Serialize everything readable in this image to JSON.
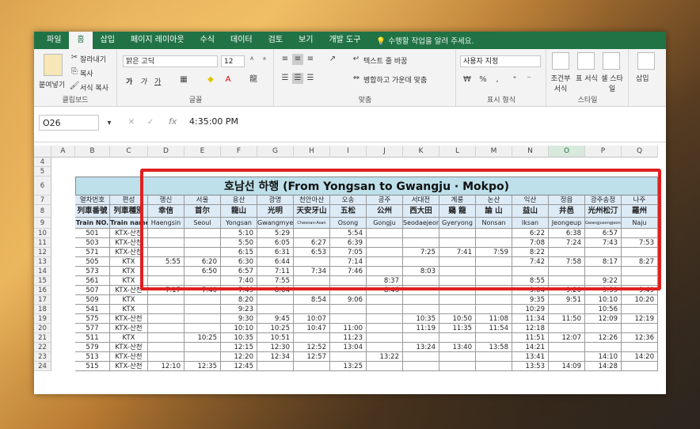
{
  "ribbon": {
    "tabs": [
      "파일",
      "홈",
      "삽입",
      "페이지 레이아웃",
      "수식",
      "데이터",
      "검토",
      "보기",
      "개발 도구"
    ],
    "active_tab": "홈",
    "tell_me": "수행할 작업을 알려 주세요.",
    "clipboard": {
      "paste": "붙여넣기",
      "cut": "잘라내기",
      "copy": "복사",
      "format_painter": "서식 복사",
      "label": "클립보드"
    },
    "font": {
      "name": "맑은 고딕",
      "size": "12",
      "label": "글꼴",
      "bold": "가",
      "italic": "가",
      "underline": "가"
    },
    "alignment": {
      "wrap": "텍스트 줄 바꿈",
      "merge": "병합하고 가운데 맞춤",
      "label": "맞춤"
    },
    "number": {
      "format": "사용자 지정",
      "label": "표시 형식"
    },
    "styles": {
      "conditional": "조건부 서식",
      "table": "표 서식",
      "cell": "셀 스타일",
      "label": "스타일"
    },
    "cells": {
      "insert": "삽입"
    }
  },
  "formula_bar": {
    "name_box": "O26",
    "value": "4:35:00 PM",
    "fx": "fx"
  },
  "columns": [
    "A",
    "B",
    "C",
    "D",
    "E",
    "F",
    "G",
    "H",
    "I",
    "J",
    "K",
    "L",
    "M",
    "N",
    "O",
    "P",
    "Q"
  ],
  "selected_column": "O",
  "row_numbers": [
    "4",
    "5",
    "6",
    "7",
    "8",
    "9",
    "10",
    "11",
    "12",
    "13",
    "14",
    "15",
    "16",
    "17",
    "18",
    "19",
    "20",
    "21",
    "22",
    "23",
    "24"
  ],
  "table": {
    "title": "호남선 하행 (From Yongsan to Gwangju · Mokpo)",
    "header_ko": [
      "열차번호",
      "편성",
      "행신",
      "서울",
      "용산",
      "광명",
      "천안아산",
      "오송",
      "공주",
      "서대전",
      "계룡",
      "논산",
      "익산",
      "정읍",
      "광주송정",
      "나주"
    ],
    "header_hanja": [
      "列車番號",
      "列車種別",
      "幸信",
      "首尔",
      "龍山",
      "光明",
      "天安牙山",
      "五松",
      "公州",
      "西大田",
      "鷄 龍",
      "論 山",
      "益山",
      "井邑",
      "光州松汀",
      "羅州"
    ],
    "header_en": [
      "Train NO.",
      "Train name",
      "Haengsin",
      "Seoul",
      "Yongsan",
      "Gwangmyeong",
      "Cheonan-Asan",
      "Osong",
      "Gongju",
      "Seodaejeon",
      "Gyeryong",
      "Nonsan",
      "Iksan",
      "Jeongeup",
      "Gwangjusongjeong",
      "Naju"
    ],
    "rows": [
      [
        "501",
        "KTX-산천",
        "",
        "",
        "5:10",
        "5:29",
        "",
        "5:54",
        "",
        "",
        "",
        "",
        "6:22",
        "6:38",
        "6:57",
        ""
      ],
      [
        "503",
        "KTX-산천",
        "",
        "",
        "5:50",
        "6:05",
        "6:27",
        "6:39",
        "",
        "",
        "",
        "",
        "7:08",
        "7:24",
        "7:43",
        "7:53"
      ],
      [
        "571",
        "KTX-산천",
        "",
        "",
        "6:15",
        "6:31",
        "6:53",
        "7:05",
        "",
        "7:25",
        "7:41",
        "7:59",
        "8:22",
        "",
        "",
        ""
      ],
      [
        "505",
        "KTX",
        "5:55",
        "6:20",
        "6:30",
        "6:44",
        "",
        "7:14",
        "",
        "",
        "",
        "",
        "7:42",
        "7:58",
        "8:17",
        "8:27"
      ],
      [
        "573",
        "KTX",
        "",
        "6:50",
        "6:57",
        "7:11",
        "7:34",
        "7:46",
        "",
        "8:03",
        "",
        "",
        "",
        "",
        "",
        ""
      ],
      [
        "561",
        "KTX",
        "",
        "",
        "7:40",
        "7:55",
        "",
        "",
        "8:37",
        "",
        "",
        "",
        "8:55",
        "",
        "9:22",
        ""
      ],
      [
        "507",
        "KTX-산천",
        "7:17",
        "7:40",
        "7:49",
        "8:04",
        "",
        "",
        "8:46",
        "",
        "",
        "",
        "9:04",
        "9:20",
        "9:39",
        "9:49"
      ],
      [
        "509",
        "KTX",
        "",
        "",
        "8:20",
        "",
        "8:54",
        "9:06",
        "",
        "",
        "",
        "",
        "9:35",
        "9:51",
        "10:10",
        "10:20"
      ],
      [
        "541",
        "KTX",
        "",
        "",
        "9:23",
        "",
        "",
        "",
        "",
        "",
        "",
        "",
        "10:29",
        "",
        "10:56",
        ""
      ],
      [
        "575",
        "KTX-산천",
        "",
        "",
        "9:30",
        "9:45",
        "10:07",
        "",
        "",
        "10:35",
        "10:50",
        "11:08",
        "11:34",
        "11:50",
        "12:09",
        "12:19"
      ],
      [
        "577",
        "KTX-산천",
        "",
        "",
        "10:10",
        "10:25",
        "10:47",
        "11:00",
        "",
        "11:19",
        "11:35",
        "11:54",
        "12:18",
        "",
        "",
        ""
      ],
      [
        "511",
        "KTX",
        "",
        "10:25",
        "10:35",
        "10:51",
        "",
        "11:23",
        "",
        "",
        "",
        "",
        "11:51",
        "12:07",
        "12:26",
        "12:36"
      ],
      [
        "579",
        "KTX-산천",
        "",
        "",
        "12:15",
        "12:30",
        "12:52",
        "13:04",
        "",
        "13:24",
        "13:40",
        "13:58",
        "14:21",
        "",
        "",
        ""
      ],
      [
        "513",
        "KTX-산천",
        "",
        "",
        "12:20",
        "12:34",
        "12:57",
        "",
        "13:22",
        "",
        "",
        "",
        "13:41",
        "",
        "14:10",
        "14:20"
      ],
      [
        "515",
        "KTX-산천",
        "12:10",
        "12:35",
        "12:45",
        "",
        "",
        "13:25",
        "",
        "",
        "",
        "",
        "13:53",
        "14:09",
        "14:28",
        ""
      ]
    ]
  }
}
